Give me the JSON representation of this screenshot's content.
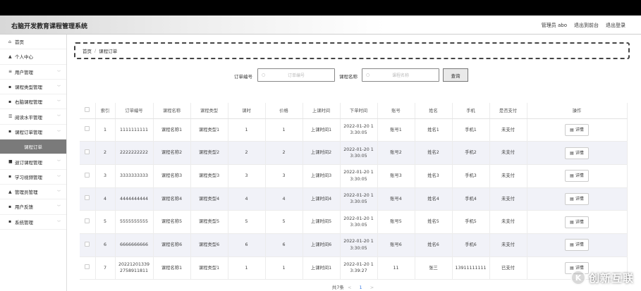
{
  "header": {
    "brand": "右脑开发教育课程管理系统",
    "user": "管理员 abo",
    "to_front": "退出到前台",
    "logout": "退出登录"
  },
  "sidebar": {
    "items": [
      {
        "label": "首页",
        "icon": "home-icon",
        "glyph": "⌂"
      },
      {
        "label": "个人中心",
        "icon": "person-icon",
        "glyph": "▲"
      },
      {
        "label": "用户管理",
        "icon": "list-icon",
        "glyph": "≡"
      },
      {
        "label": "课程类型管理",
        "icon": "grid-icon",
        "glyph": "▪"
      },
      {
        "label": "右脑课程管理",
        "icon": "grid-icon",
        "glyph": "▪"
      },
      {
        "label": "阅读水平管理",
        "icon": "sliders-icon",
        "glyph": "☰"
      },
      {
        "label": "课程订单管理",
        "icon": "grid-icon",
        "glyph": "▪"
      },
      {
        "label": "课程订单",
        "icon": "",
        "glyph": ""
      },
      {
        "label": "退订课程管理",
        "icon": "box-icon",
        "glyph": "■"
      },
      {
        "label": "学习视频管理",
        "icon": "grid-icon",
        "glyph": "▪"
      },
      {
        "label": "管理员管理",
        "icon": "person-icon",
        "glyph": "▲"
      },
      {
        "label": "用户反馈",
        "icon": "grid-icon",
        "glyph": "▪"
      },
      {
        "label": "系统管理",
        "icon": "grid-icon",
        "glyph": "▪"
      }
    ]
  },
  "breadcrumb": {
    "home": "首页",
    "sep": "/",
    "current": "课程订单"
  },
  "search": {
    "order_label": "订单编号",
    "order_placeholder": "订单编号",
    "course_label": "课程名称",
    "course_placeholder": "课程名称",
    "button": "查询"
  },
  "table": {
    "headers": [
      "",
      "索引",
      "订单编号",
      "课程名称",
      "课程类型",
      "课时",
      "价格",
      "上课时间",
      "下单时间",
      "账号",
      "姓名",
      "手机",
      "是否支付",
      "操作"
    ],
    "detail_label": "详情",
    "rows": [
      {
        "idx": "1",
        "order": "1111111111",
        "course": "课程名称1",
        "type": "课程类型1",
        "hours": "1",
        "price": "1",
        "class_time": "上课时间1",
        "order_time_a": "2022-01-20 1",
        "order_time_b": "3:30:05",
        "account": "账号1",
        "name": "姓名1",
        "phone": "手机1",
        "paid": "未支付"
      },
      {
        "idx": "2",
        "order": "2222222222",
        "course": "课程名称2",
        "type": "课程类型2",
        "hours": "2",
        "price": "2",
        "class_time": "上课时间2",
        "order_time_a": "2022-01-20 1",
        "order_time_b": "3:30:05",
        "account": "账号2",
        "name": "姓名2",
        "phone": "手机2",
        "paid": "未支付"
      },
      {
        "idx": "3",
        "order": "3333333333",
        "course": "课程名称3",
        "type": "课程类型3",
        "hours": "3",
        "price": "3",
        "class_time": "上课时间3",
        "order_time_a": "2022-01-20 1",
        "order_time_b": "3:30:05",
        "account": "账号3",
        "name": "姓名3",
        "phone": "手机3",
        "paid": "未支付"
      },
      {
        "idx": "4",
        "order": "4444444444",
        "course": "课程名称4",
        "type": "课程类型4",
        "hours": "4",
        "price": "4",
        "class_time": "上课时间4",
        "order_time_a": "2022-01-20 1",
        "order_time_b": "3:30:05",
        "account": "账号4",
        "name": "姓名4",
        "phone": "手机4",
        "paid": "未支付"
      },
      {
        "idx": "5",
        "order": "5555555555",
        "course": "课程名称5",
        "type": "课程类型5",
        "hours": "5",
        "price": "5",
        "class_time": "上课时间5",
        "order_time_a": "2022-01-20 1",
        "order_time_b": "3:30:05",
        "account": "账号5",
        "name": "姓名5",
        "phone": "手机5",
        "paid": "未支付"
      },
      {
        "idx": "6",
        "order": "6666666666",
        "course": "课程名称6",
        "type": "课程类型6",
        "hours": "6",
        "price": "6",
        "class_time": "上课时间6",
        "order_time_a": "2022-01-20 1",
        "order_time_b": "3:30:05",
        "account": "账号6",
        "name": "姓名6",
        "phone": "手机6",
        "paid": "未支付"
      },
      {
        "idx": "7",
        "order": "20221201339 2758911811",
        "course": "课程名称1",
        "type": "课程类型1",
        "hours": "1",
        "price": "1",
        "class_time": "上课时间1",
        "order_time_a": "2022-01-20 1",
        "order_time_b": "3:39:27",
        "account": "11",
        "name": "张三",
        "phone": "13911111111",
        "paid": "已支付"
      }
    ]
  },
  "pager": {
    "total": "共7条",
    "prev": "<",
    "page": "1",
    "next": ">"
  },
  "watermark": {
    "text": "创新互联",
    "logo": "K"
  }
}
